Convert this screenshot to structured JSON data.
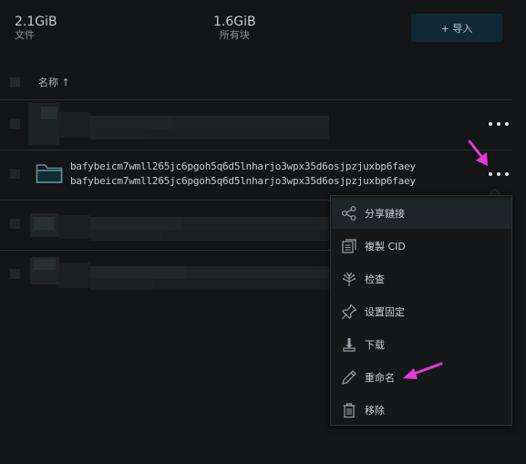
{
  "stats": {
    "files_value": "2.1GiB",
    "files_label": "文件",
    "blocks_value": "1.6GiB",
    "blocks_label": "所有块"
  },
  "toolbar": {
    "import_label": "+ 导入"
  },
  "table": {
    "name_header": "名称 ↑"
  },
  "rows": [
    {
      "redacted": true
    },
    {
      "name_line1": "bafybeicm7wmll265jc6pgoh5q6d5lnharjo3wpx35d6osjpzjuxbp6faey",
      "name_line2": "bafybeicm7wmll265jc6pgoh5q6d5lnharjo3wpx35d6osjpzjuxbp6faey",
      "icon": "folder-icon"
    },
    {
      "redacted": true
    },
    {
      "redacted": true
    }
  ],
  "context_menu": {
    "items": [
      {
        "label": "分享鏈接",
        "icon": "share-icon"
      },
      {
        "label": "複製 CID",
        "icon": "copy-icon"
      },
      {
        "label": "检查",
        "icon": "inspect-icon"
      },
      {
        "label": "设置固定",
        "icon": "pin-icon"
      },
      {
        "label": "下载",
        "icon": "download-icon"
      },
      {
        "label": "重命名",
        "icon": "pencil-icon"
      },
      {
        "label": "移除",
        "icon": "trash-icon"
      }
    ]
  },
  "colors": {
    "background": "#141516",
    "accent_arrow": "#e23ad8",
    "menu_bg": "#151819",
    "import_bg": "#0f2a36"
  }
}
